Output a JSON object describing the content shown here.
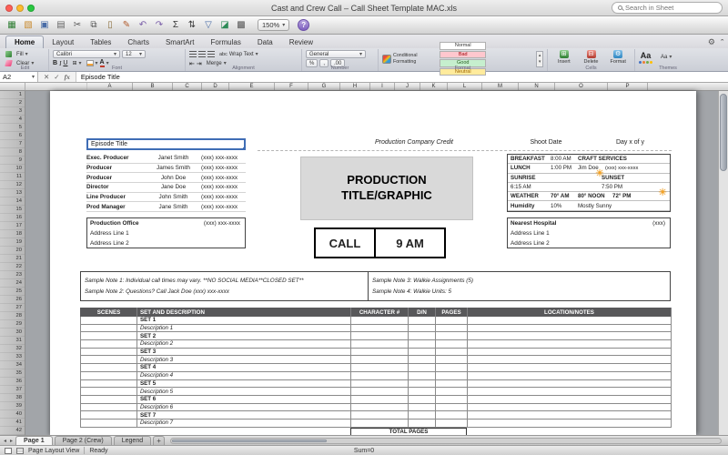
{
  "titlebar": {
    "title": "Cast and Crew Call – Call Sheet Template MAC.xls",
    "search_placeholder": "Search in Sheet"
  },
  "icons": {
    "chevron_down": "▾",
    "sun": "☀",
    "gear": "⚙",
    "collapse": "ˆ",
    "tab_prev": "◂",
    "tab_next": "▸",
    "up": "▴",
    "down": "▾"
  },
  "toolbar": {
    "icons": [
      {
        "name": "new-workbook-icon",
        "glyph": "▦",
        "color": "#2e7d32"
      },
      {
        "name": "open-icon",
        "glyph": "▧",
        "color": "#c98a2d"
      },
      {
        "name": "save-icon",
        "glyph": "▣",
        "color": "#4a6da7"
      },
      {
        "name": "print-icon",
        "glyph": "▤",
        "color": "#666666"
      },
      {
        "name": "cut-icon",
        "glyph": "✂",
        "color": "#555555"
      },
      {
        "name": "copy-icon",
        "glyph": "⧉",
        "color": "#555555"
      },
      {
        "name": "paste-icon",
        "glyph": "▯",
        "color": "#8a6d3b"
      },
      {
        "name": "format-painter-icon",
        "glyph": "✎",
        "color": "#b05a2a"
      },
      {
        "name": "undo-icon",
        "glyph": "↶",
        "color": "#7a5ea8"
      },
      {
        "name": "redo-icon",
        "glyph": "↷",
        "color": "#7a5ea8"
      },
      {
        "name": "autosum-icon",
        "glyph": "Σ",
        "color": "#333333"
      },
      {
        "name": "sort-icon",
        "glyph": "⇅",
        "color": "#333333"
      },
      {
        "name": "filter-icon",
        "glyph": "▽",
        "color": "#4a6da7"
      },
      {
        "name": "gallery-icon",
        "glyph": "◪",
        "color": "#2e8b57"
      },
      {
        "name": "toolbox-icon",
        "glyph": "▩",
        "color": "#555555"
      }
    ],
    "zoom_value": "150%",
    "help_label": "?"
  },
  "ribbon": {
    "tabs": [
      "Home",
      "Layout",
      "Tables",
      "Charts",
      "SmartArt",
      "Formulas",
      "Data",
      "Review"
    ],
    "groups": {
      "edit": {
        "label": "Edit",
        "fill": "Fill",
        "clear": "Clear"
      },
      "font": {
        "label": "Font",
        "family": "Calibri",
        "size": "12",
        "bold": "B",
        "italic": "I",
        "underline": "U",
        "borders": "⊞",
        "color_letter": "A"
      },
      "alignment": {
        "label": "Alignment",
        "abc": "abc",
        "wrap": "Wrap Text",
        "merge": "Merge",
        "indent_left": "⇤",
        "indent_right": "⇥"
      },
      "number": {
        "label": "Number",
        "format": "General",
        "percent": "%",
        "comma": ",",
        "decimal": ".00"
      },
      "format": {
        "label": "Format",
        "conditional": "Conditional Formatting",
        "styles": [
          "Normal",
          "Bad",
          "Good",
          "Neutral"
        ]
      },
      "cells": {
        "label": "Cells",
        "insert": "Insert",
        "delete": "Delete",
        "format": "Format",
        "insert_glyph": "⊞",
        "delete_glyph": "⊟",
        "format_glyph": "⚙"
      },
      "themes": {
        "label": "Themes",
        "aa": "Aa"
      }
    }
  },
  "formula_bar": {
    "cell_ref": "A2",
    "cancel": "✕",
    "accept": "✓",
    "fx": "fx",
    "value": "Episode Title"
  },
  "grid": {
    "columns": [
      "A",
      "B",
      "C",
      "D",
      "E",
      "F",
      "G",
      "H",
      "I",
      "J",
      "K",
      "L",
      "M",
      "N",
      "O",
      "P"
    ],
    "rows": [
      "1",
      "2",
      "3",
      "4",
      "5",
      "6",
      "7",
      "8",
      "9",
      "10",
      "11",
      "12",
      "13",
      "14",
      "15",
      "16",
      "17",
      "18",
      "19",
      "20",
      "21",
      "22",
      "23",
      "24",
      "25",
      "26",
      "27",
      "28",
      "29",
      "30",
      "31",
      "32",
      "33",
      "34",
      "35",
      "36",
      "37",
      "38",
      "39",
      "40",
      "41",
      "42"
    ]
  },
  "sheet": {
    "episode_title": "Episode Title",
    "company_credit": "Production Company Credit",
    "shoot_date": "Shoot Date",
    "day_of": "Day x of y",
    "crew": [
      {
        "role": "Exec. Producer",
        "name": "Janet Smith",
        "phone": "(xxx) xxx-xxxx"
      },
      {
        "role": "Producer",
        "name": "James Smith",
        "phone": "(xxx) xxx-xxxx"
      },
      {
        "role": "Producer",
        "name": "John Doe",
        "phone": "(xxx) xxx-xxxx"
      },
      {
        "role": "Director",
        "name": "Jane Doe",
        "phone": "(xxx) xxx-xxxx"
      },
      {
        "role": "Line Producer",
        "name": "John Smith",
        "phone": "(xxx) xxx-xxxx"
      },
      {
        "role": "Prod Manager",
        "name": "Jane Smith",
        "phone": "(xxx) xxx-xxxx"
      }
    ],
    "production_title_line1": "PRODUCTION",
    "production_title_line2": "TITLE/GRAPHIC",
    "meals": {
      "breakfast_label": "BREAKFAST",
      "breakfast_time": "8:00 AM",
      "craft_services": "CRAFT SERVICES",
      "lunch_label": "LUNCH",
      "lunch_time": "1:00 PM",
      "lunch_contact": "Jim Doe",
      "lunch_phone": "(xxx) xxx-xxxx",
      "sunrise_label": "SUNRISE",
      "sunset_label": "SUNSET",
      "sunrise_time": "6:15 AM",
      "sunset_time": "7:50 PM",
      "weather_label": "WEATHER",
      "temp_am": "70° AM",
      "temp_noon": "80° NOON",
      "temp_pm": "72° PM",
      "humidity_label": "Humidity",
      "humidity_value": "10%",
      "sky": "Mostly Sunny"
    },
    "production_office": {
      "title": "Production Office",
      "phone": "(xxx) xxx-xxxx",
      "address1": "Address Line 1",
      "address2": "Address Line 2"
    },
    "hospital": {
      "title": "Nearest Hospital",
      "phone": "(xxx)",
      "address1": "Address Line 1",
      "address2": "Address Line 2"
    },
    "call_label": "CALL",
    "call_time": "9 AM",
    "notes": {
      "note1": "Sample Note 1: Individual call times may vary. **NO SOCIAL MEDIA**CLOSED SET**",
      "note2": "Sample Note 2: Questions?  Call Jack Doe (xxx) xxx-xxxx",
      "note3": "Sample Note 3: Walkie Assignments (5)",
      "note4": "Sample Note 4: Walkie Units: 5"
    },
    "table": {
      "headers": [
        "SCENES",
        "SET AND DESCRIPTION",
        "CHARACTER #",
        "D/N",
        "PAGES",
        "LOCATION/NOTES"
      ],
      "rows": [
        {
          "set": "SET 1",
          "desc": "Description 1"
        },
        {
          "set": "SET 2",
          "desc": "Description 2"
        },
        {
          "set": "SET 3",
          "desc": "Description 3"
        },
        {
          "set": "SET 4",
          "desc": "Description 4"
        },
        {
          "set": "SET 5",
          "desc": "Description 5"
        },
        {
          "set": "SET 6",
          "desc": "Description 6"
        },
        {
          "set": "SET 7",
          "desc": "Description 7"
        }
      ],
      "total_label": "TOTAL PAGES"
    }
  },
  "sheet_tabs": {
    "tabs": [
      "Page 1",
      "Page 2 (Crew)",
      "Legend"
    ],
    "add": "+"
  },
  "status_bar": {
    "view": "Page Layout View",
    "ready": "Ready",
    "sum": "Sum=0"
  }
}
